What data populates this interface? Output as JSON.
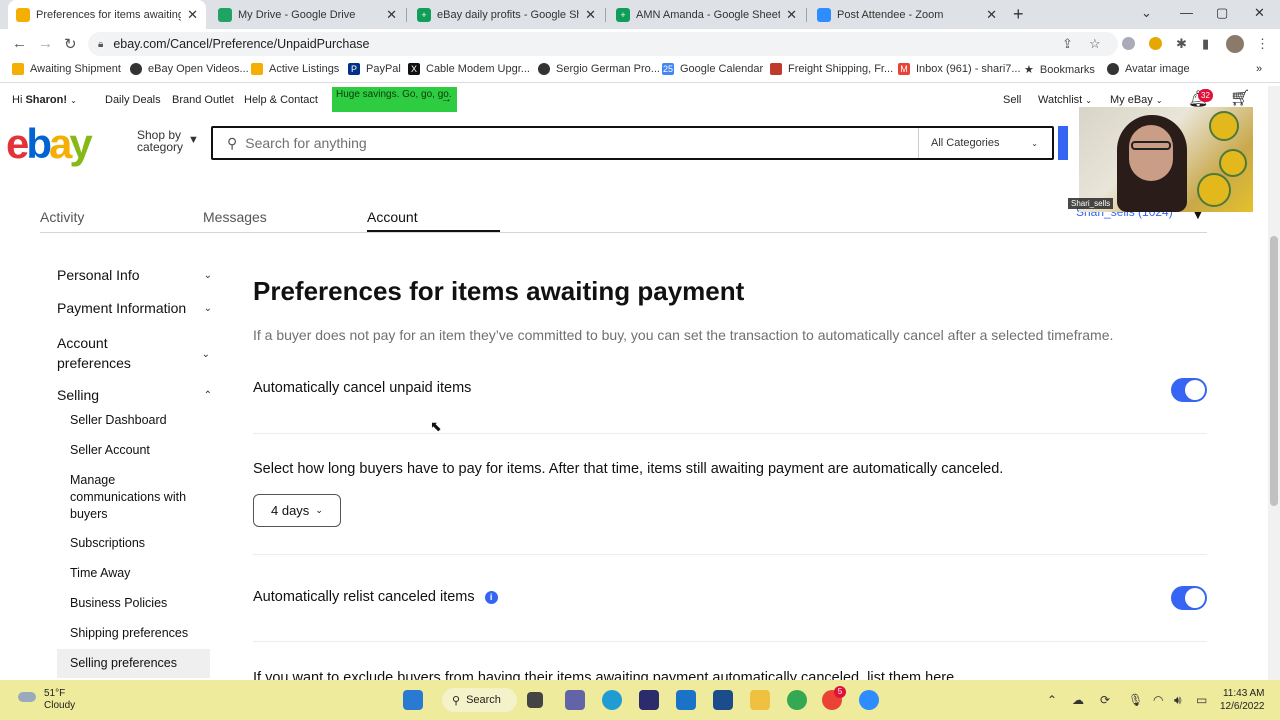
{
  "browser": {
    "tabs": [
      {
        "title": "Preferences for items awaiting pa",
        "color": "#f5af02",
        "active": true
      },
      {
        "title": "My Drive - Google Drive",
        "color": "#1fa463"
      },
      {
        "title": "eBay daily profits - Google Shee",
        "color": "#0f9d58"
      },
      {
        "title": "AMN Amanda - Google Sheets",
        "color": "#0f9d58"
      },
      {
        "title": "Post Attendee - Zoom",
        "color": "#2d8cff"
      }
    ],
    "url": "ebay.com/Cancel/Preference/UnpaidPurchase",
    "bookmarks": [
      {
        "label": "Awaiting Shipment",
        "color": "#f5af02"
      },
      {
        "label": "eBay Open Videos...",
        "color": "#333333"
      },
      {
        "label": "Active Listings",
        "color": "#f5af02"
      },
      {
        "label": "PayPal",
        "color": "#003087"
      },
      {
        "label": "Cable Modem Upgr...",
        "color": "#111111"
      },
      {
        "label": "Sergio German Pro...",
        "color": "#333333"
      },
      {
        "label": "Google Calendar",
        "color": "#4285f4"
      },
      {
        "label": "Freight Shipping, Fr...",
        "color": "#c0392b"
      },
      {
        "label": "Inbox (961) - shari7...",
        "color": "#ea4335"
      },
      {
        "label": "Bookmarks",
        "color": "#333333"
      },
      {
        "label": "Avatar image",
        "color": "#333333"
      }
    ]
  },
  "header": {
    "greeting_prefix": "Hi",
    "user_name": "Sharon!",
    "daily_deals": "Daily Deals",
    "brand_outlet": "Brand Outlet",
    "help_contact": "Help & Contact",
    "promo": "Huge savings. Go, go, go.",
    "sell": "Sell",
    "watchlist": "Watchlist",
    "my_ebay": "My eBay",
    "notification_count": "32",
    "logo": [
      "e",
      "b",
      "a",
      "y"
    ],
    "shop_by": "Shop by category",
    "search_placeholder": "Search for anything",
    "category": "All Categories",
    "partial_username": "Shari_sells (1024)"
  },
  "tabs": [
    "Activity",
    "Messages",
    "Account"
  ],
  "sidebar": {
    "sections": [
      "Personal Info",
      "Payment Information",
      "Account preferences",
      "Selling"
    ],
    "selling_items": [
      "Seller Dashboard",
      "Seller Account",
      "Manage communications with buyers",
      "Subscriptions",
      "Time Away",
      "Business Policies",
      "Shipping preferences",
      "Selling preferences"
    ]
  },
  "main": {
    "title": "Preferences for items awaiting payment",
    "description": "If a buyer does not pay for an item they’ve committed to buy, you can set the transaction to automatically cancel after a selected timeframe.",
    "auto_cancel_label": "Automatically cancel unpaid items",
    "auto_cancel_on": true,
    "select_prompt": "Select how long buyers have to pay for items. After that time, items still awaiting payment are automatically canceled.",
    "days_value": "4 days",
    "relist_label": "Automatically relist canceled items",
    "relist_on": true,
    "exclude_text": "If you want to exclude buyers from having their items awaiting payment automatically canceled, list them here."
  },
  "webcam": {
    "name": "Shari_sells"
  },
  "taskbar": {
    "temp": "51°F",
    "weather": "Cloudy",
    "search": "Search",
    "chrome_badge": "5",
    "time": "11:43 AM",
    "date": "12/6/2022"
  }
}
